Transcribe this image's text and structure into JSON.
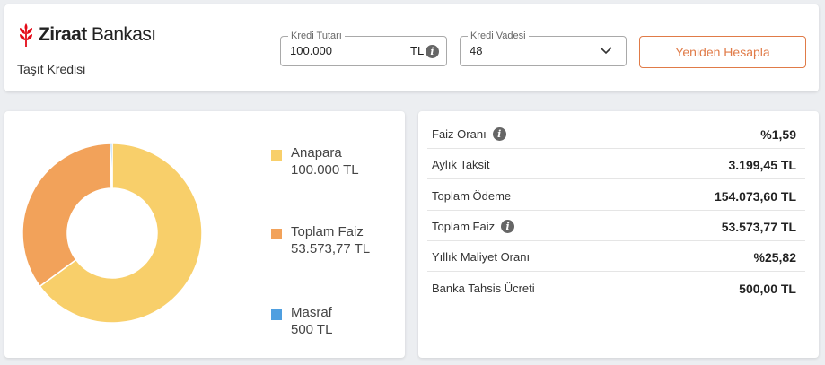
{
  "header": {
    "brand_bold": "Ziraat",
    "brand_regular": "Bankası",
    "product": "Taşıt Kredisi",
    "brand_color": "#e30a17"
  },
  "form": {
    "amount": {
      "legend": "Kredi Tutarı",
      "value": "100.000",
      "currency": "TL",
      "icon": "info-icon"
    },
    "term": {
      "legend": "Kredi Vadesi",
      "value": "48",
      "icon": "chevron-down-icon"
    },
    "recalculate_label": "Yeniden Hesapla",
    "accent_color": "#e07b48"
  },
  "chart_data": {
    "type": "pie",
    "categories": [
      "Anapara",
      "Toplam Faiz",
      "Masraf"
    ],
    "values": [
      100000,
      53573.77,
      500
    ],
    "value_labels": [
      "100.000 TL",
      "53.573,77 TL",
      "500 TL"
    ],
    "colors": [
      "#f8cf6a",
      "#f2a25a",
      "#4f9fe0"
    ],
    "donut": true,
    "legend": "right"
  },
  "details": [
    {
      "label": "Faiz Oranı",
      "value": "%1,59",
      "info": true
    },
    {
      "label": "Aylık Taksit",
      "value": "3.199,45 TL",
      "info": false
    },
    {
      "label": "Toplam Ödeme",
      "value": "154.073,60 TL",
      "info": false
    },
    {
      "label": "Toplam Faiz",
      "value": "53.573,77 TL",
      "info": true
    },
    {
      "label": "Yıllık Maliyet Oranı",
      "value": "%25,82",
      "info": false
    },
    {
      "label": "Banka Tahsis Ücreti",
      "value": "500,00 TL",
      "info": false
    }
  ]
}
